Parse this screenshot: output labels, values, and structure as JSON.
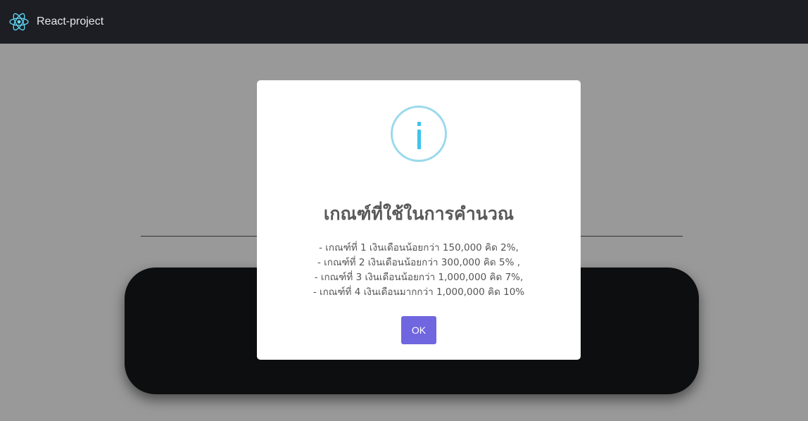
{
  "navbar": {
    "brand": "React-project",
    "logo_icon": "react-atom-icon",
    "logo_color": "#61dafb"
  },
  "dialog": {
    "icon": "info-icon",
    "icon_color": "#3fc3ee",
    "title": "เกณฑ์ที่ใช้ในการคำนวณ",
    "lines": [
      "- เกณฑ์ที่ 1 เงินเดือนน้อยกว่า 150,000 คิด 2%,",
      "- เกณฑ์ที่ 2 เงินเดือนน้อยกว่า 300,000 คิด 5% ,",
      "- เกณฑ์ที่ 3 เงินเดือนน้อยกว่า 1,000,000 คิด 7%,",
      "- เกณฑ์ที่ 4 เงินเดือนมากกว่า 1,000,000 คิด 10%"
    ],
    "confirm_label": "OK",
    "confirm_color": "#7066e0"
  }
}
